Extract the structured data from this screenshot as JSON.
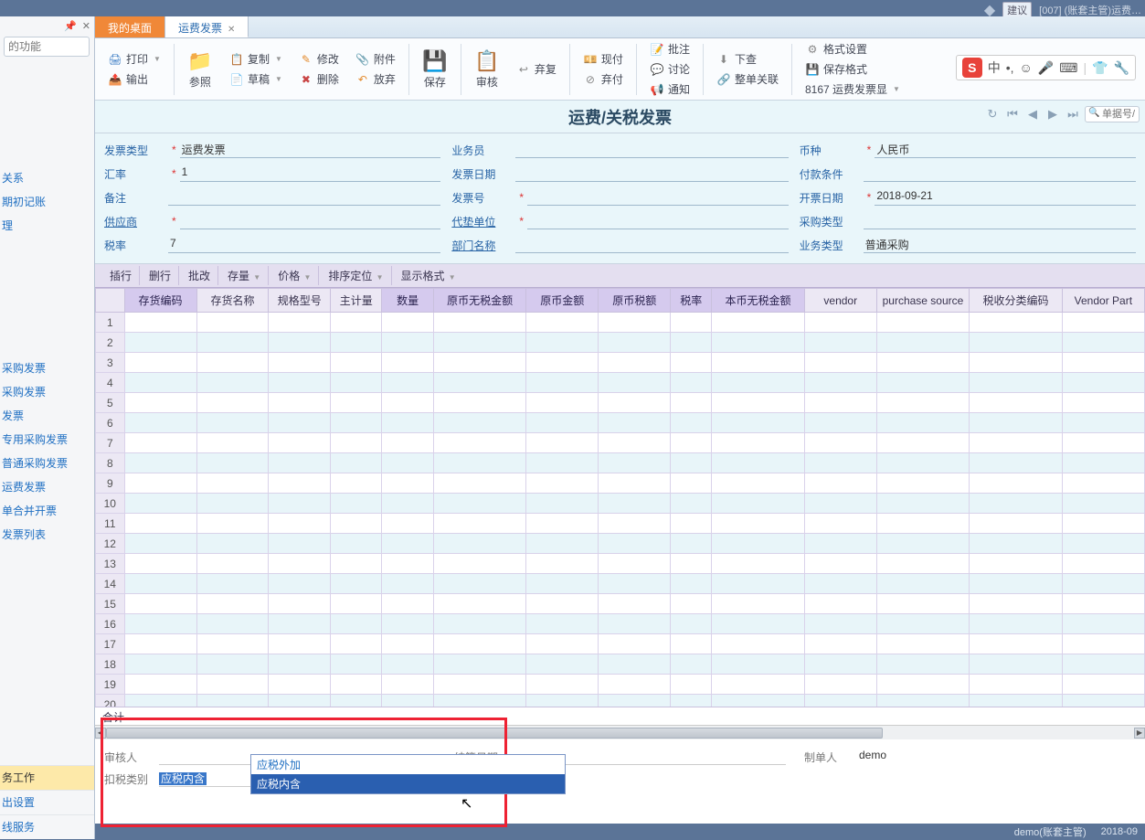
{
  "topbar": {
    "right_text": "[007] (账套主管)运费…",
    "badge": "建议"
  },
  "left_panel": {
    "search_placeholder": "的功能",
    "nav_items_top": [
      "关系",
      "期初记账",
      "理"
    ],
    "nav_items_mid": [
      "采购发票",
      "采购发票",
      "发票",
      "专用采购发票",
      "普通采购发票",
      "运费发票",
      "单合并开票",
      "发票列表"
    ],
    "nav_items_bottom": [
      "务工作",
      "出设置",
      "线服务"
    ]
  },
  "tabs": [
    {
      "label": "我的桌面",
      "active": false
    },
    {
      "label": "运费发票",
      "active": true
    }
  ],
  "ribbon": {
    "print": "打印",
    "export": "输出",
    "ref": "参照",
    "copy": "复制",
    "draft": "草稿",
    "modify": "修改",
    "delete": "删除",
    "attach": "附件",
    "discard": "放弃",
    "save": "保存",
    "audit": "审核",
    "rollback": "弃复",
    "pay": "现付",
    "abandon": "弃付",
    "approve": "批注",
    "discuss": "讨论",
    "notify": "通知",
    "down": "下查",
    "assoc": "整单关联",
    "format": "格式设置",
    "save_format": "保存格式",
    "template": "8167 运费发票显"
  },
  "title": "运费/关税发票",
  "title_search_placeholder": "单据号/条",
  "form": {
    "col1": {
      "type_label": "发票类型",
      "type_val": "运费发票",
      "rate_label": "汇率",
      "rate_val": "1",
      "note_label": "备注",
      "note_val": "",
      "supplier_label": "供应商",
      "supplier_val": "",
      "tax_label": "税率",
      "tax_val": "7"
    },
    "col2": {
      "biz_label": "业务员",
      "biz_val": "",
      "date_label": "发票日期",
      "date_val": "",
      "num_label": "发票号",
      "num_val": "",
      "agent_label": "代垫单位",
      "agent_val": "",
      "dept_label": "部门名称",
      "dept_val": ""
    },
    "col3": {
      "curr_label": "币种",
      "curr_val": "人民币",
      "pay_label": "付款条件",
      "pay_val": "",
      "open_label": "开票日期",
      "open_val": "2018-09-21",
      "purch_label": "采购类型",
      "purch_val": "",
      "biztype_label": "业务类型",
      "biztype_val": "普通采购"
    }
  },
  "grid_toolbar": [
    "插行",
    "删行",
    "批改",
    "存量",
    "价格",
    "排序定位",
    "显示格式"
  ],
  "grid": {
    "columns": [
      "",
      "存货编码",
      "存货名称",
      "规格型号",
      "主计量",
      "数量",
      "原币无税金额",
      "原币金额",
      "原币税额",
      "税率",
      "本币无税金额",
      "vendor",
      "purchase source",
      "税收分类编码",
      "Vendor Part"
    ],
    "row_count": 20,
    "total_label": "合计"
  },
  "footer": {
    "reviewer_label": "审核人",
    "reviewer_val": "",
    "deduct_label": "扣税类别",
    "deduct_val": "应税内含",
    "settle_label": "结算日期",
    "settle_val": "",
    "maker_label": "制单人",
    "maker_val": "demo",
    "dd_options": [
      "应税外加",
      "应税内含"
    ]
  },
  "statusbar": {
    "user": "demo(账套主管)",
    "date": "2018-09"
  }
}
